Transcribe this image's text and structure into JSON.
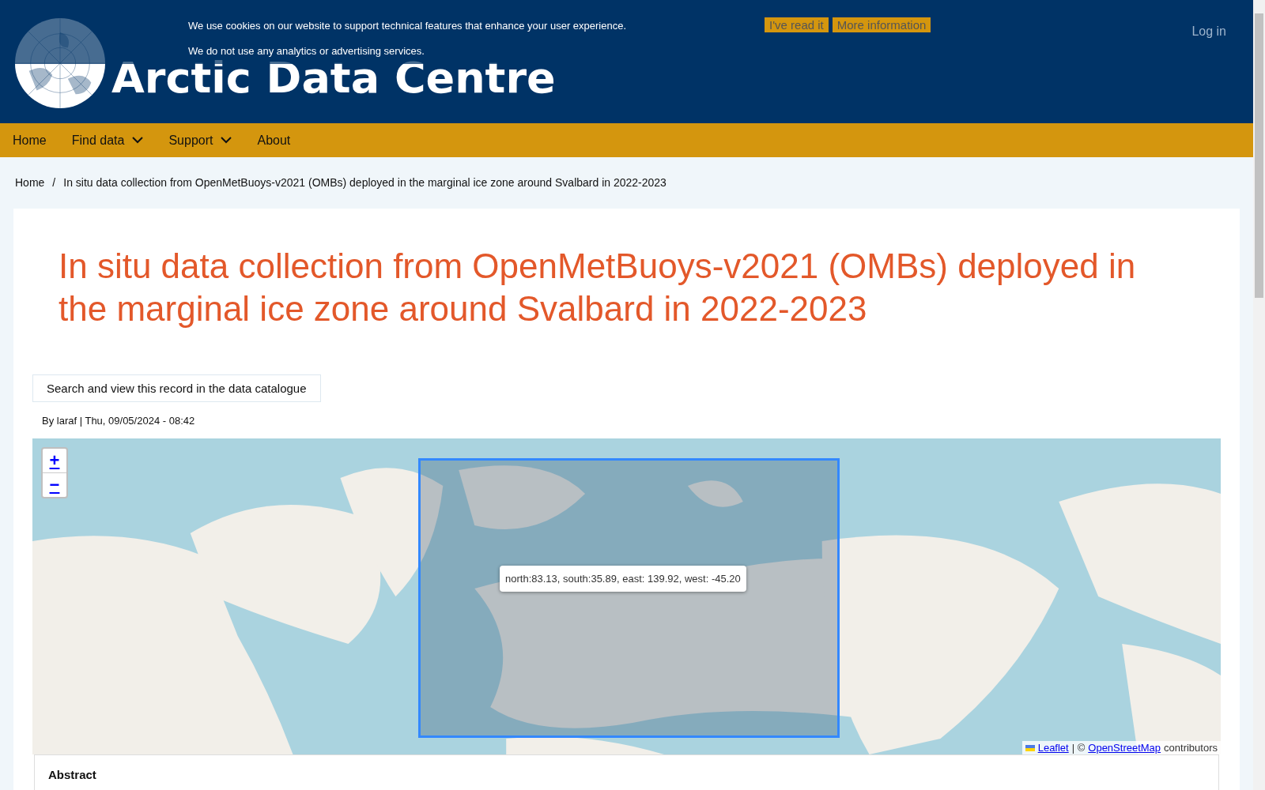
{
  "header": {
    "logo_text": "Arctic Data Centre",
    "login": "Log in"
  },
  "cookie_banner": {
    "lines": [
      "We use cookies on our website to support technical features that enhance your user experience.",
      "We do not use any analytics or advertising services."
    ],
    "buttons": [
      "I've read it",
      "More information"
    ]
  },
  "nav": [
    {
      "label": "Home",
      "dropdown": false
    },
    {
      "label": "Find data",
      "dropdown": true
    },
    {
      "label": "Support",
      "dropdown": true
    },
    {
      "label": "About",
      "dropdown": false
    }
  ],
  "breadcrumb_separator": "/",
  "breadcrumb": [
    "Home",
    "In situ data collection from OpenMetBuoys-v2021 (OMBs) deployed in the marginal ice zone around Svalbard in 2022-2023"
  ],
  "title": "In situ data collection from OpenMetBuoys-v2021 (OMBs) deployed in the marginal ice zone around Svalbard in 2022-2023",
  "catalogue_button": "Search and view this record in the data catalogue",
  "byline": "By laraf | Thu, 09/05/2024 - 08:42",
  "map": {
    "zoom_in": "+",
    "zoom_out": "−",
    "tooltip": "north:83.13, south:35.89, east: 139.92, west: -45.20",
    "attribution": {
      "leaflet": "Leaflet",
      "separator": "| ©",
      "osm": "OpenStreetMap",
      "suffix": "contributors"
    }
  },
  "abstract": {
    "heading": "Abstract"
  }
}
